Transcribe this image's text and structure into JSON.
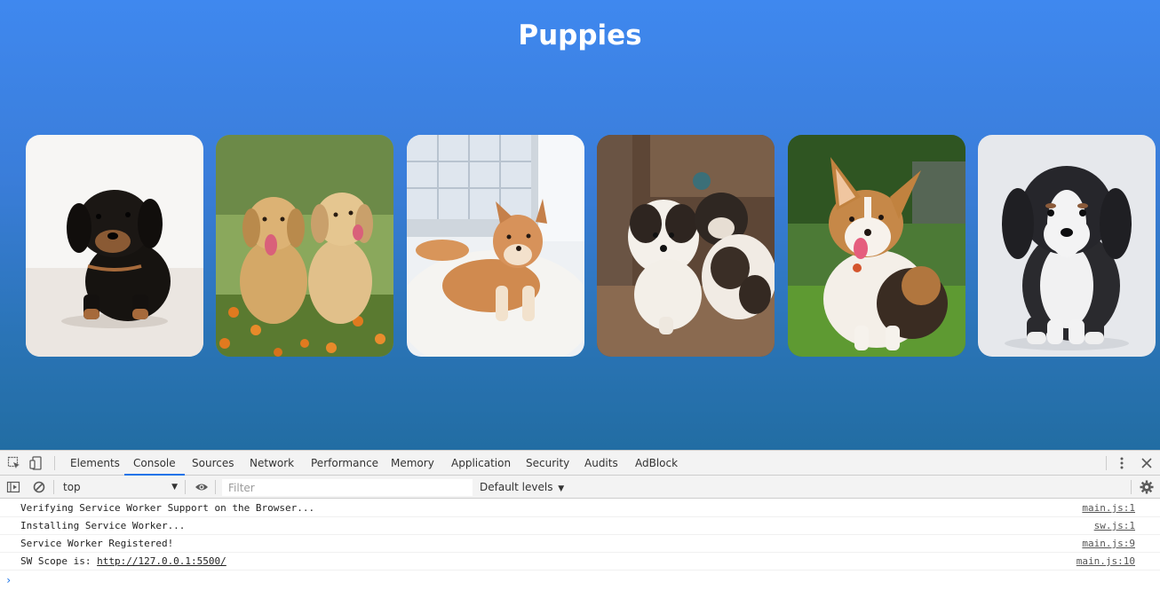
{
  "page": {
    "title": "Puppies",
    "background_top": "#3f88ef",
    "background_bottom": "#226da3"
  },
  "puppies": [
    {
      "name": "black-dachshund-puppy",
      "bg": "#f2f0ee"
    },
    {
      "name": "golden-retriever-puppies",
      "bg": "#6f8f3f"
    },
    {
      "name": "shiba-inu-puppy",
      "bg": "#e9ecef"
    },
    {
      "name": "shih-tzu-puppies",
      "bg": "#5a4233"
    },
    {
      "name": "corgi-puppy",
      "bg": "#3e6b2a"
    },
    {
      "name": "bernedoodle-puppy",
      "bg": "#e3e6ea"
    }
  ],
  "devtools": {
    "tabs": [
      "Elements",
      "Console",
      "Sources",
      "Network",
      "Performance",
      "Memory",
      "Application",
      "Security",
      "Audits",
      "AdBlock"
    ],
    "active_tab": "Console",
    "context": "top",
    "filter_placeholder": "Filter",
    "levels": "Default levels",
    "logs": [
      {
        "message": "Verifying Service Worker Support on the Browser...",
        "source": "main.js:1"
      },
      {
        "message": "Installing Service Worker...",
        "source": "sw.js:1"
      },
      {
        "message": "Service Worker Registered!",
        "source": "main.js:9"
      },
      {
        "message": "SW Scope is: ",
        "link": "http://127.0.0.1:5500/",
        "source": "main.js:10"
      }
    ],
    "prompt": "›",
    "accent": "#1a73e8"
  }
}
